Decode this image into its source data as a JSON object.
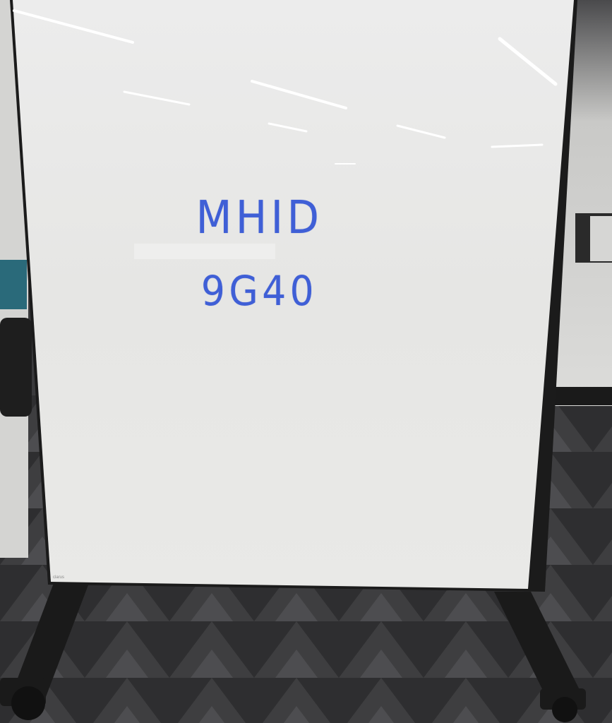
{
  "whiteboard": {
    "line1": "MHID",
    "line2": "9G40",
    "marker_color": "#3f5fd6",
    "maker_label": "clarus"
  },
  "colors": {
    "board_surface": "#e8e8e6",
    "board_frame": "#1c1c1c",
    "carpet_dark": "#2d2d2f",
    "carpet_light": "#6b6b6d",
    "wall": "#d9d9d7"
  }
}
